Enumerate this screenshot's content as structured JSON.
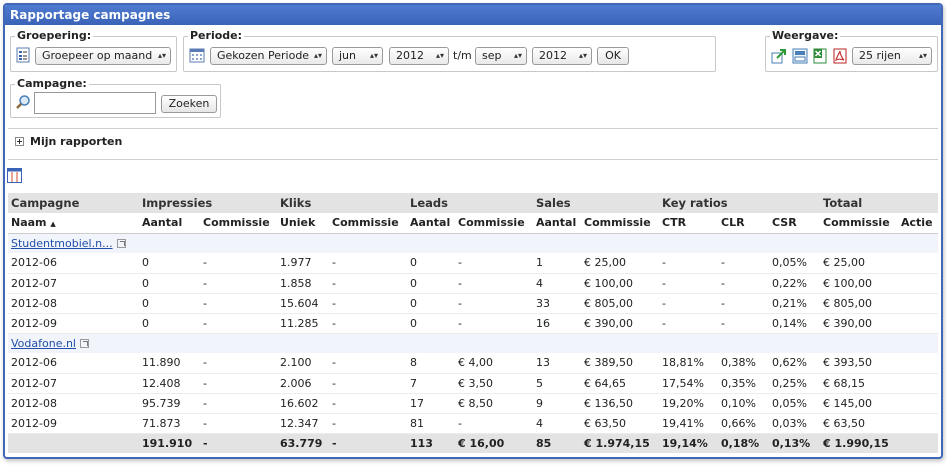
{
  "panel": {
    "title": "Rapportage campagnes"
  },
  "grouping": {
    "legend": "Groepering:",
    "value": "Groepeer op maand"
  },
  "period": {
    "legend": "Periode:",
    "mode": "Gekozen Periode",
    "from_month": "jun",
    "from_year": "2012",
    "separator": "t/m",
    "to_month": "sep",
    "to_year": "2012",
    "ok_label": "OK"
  },
  "view": {
    "legend": "Weergave:",
    "rows": "25 rijen"
  },
  "campaign_search": {
    "legend": "Campagne:",
    "value": "",
    "button": "Zoeken"
  },
  "my_reports": {
    "label": "Mijn rapporten"
  },
  "table": {
    "groups": [
      "Campagne",
      "Impressies",
      "Kliks",
      "Leads",
      "Sales",
      "Key ratios",
      "Totaal"
    ],
    "columns": [
      "Naam",
      "Aantal",
      "Commissie",
      "Uniek",
      "Commissie",
      "Aantal",
      "Commissie",
      "Aantal",
      "Commissie",
      "CTR",
      "CLR",
      "CSR",
      "Commissie",
      "Actie"
    ],
    "sort_indicator": "▲",
    "campaigns": [
      {
        "name": "Studentmobiel.n...",
        "rows": [
          [
            "2012-06",
            "0",
            "-",
            "1.977",
            "-",
            "0",
            "-",
            "1",
            "€ 25,00",
            "-",
            "-",
            "0,05%",
            "€ 25,00",
            ""
          ],
          [
            "2012-07",
            "0",
            "-",
            "1.858",
            "-",
            "0",
            "-",
            "4",
            "€ 100,00",
            "-",
            "-",
            "0,22%",
            "€ 100,00",
            ""
          ],
          [
            "2012-08",
            "0",
            "-",
            "15.604",
            "-",
            "0",
            "-",
            "33",
            "€ 805,00",
            "-",
            "-",
            "0,21%",
            "€ 805,00",
            ""
          ],
          [
            "2012-09",
            "0",
            "-",
            "11.285",
            "-",
            "0",
            "-",
            "16",
            "€ 390,00",
            "-",
            "-",
            "0,14%",
            "€ 390,00",
            ""
          ]
        ]
      },
      {
        "name": "Vodafone.nl",
        "rows": [
          [
            "2012-06",
            "11.890",
            "-",
            "2.100",
            "-",
            "8",
            "€ 4,00",
            "13",
            "€ 389,50",
            "18,81%",
            "0,38%",
            "0,62%",
            "€ 393,50",
            ""
          ],
          [
            "2012-07",
            "12.408",
            "-",
            "2.006",
            "-",
            "7",
            "€ 3,50",
            "5",
            "€ 64,65",
            "17,54%",
            "0,35%",
            "0,25%",
            "€ 68,15",
            ""
          ],
          [
            "2012-08",
            "95.739",
            "-",
            "16.602",
            "-",
            "17",
            "€ 8,50",
            "9",
            "€ 136,50",
            "19,20%",
            "0,10%",
            "0,05%",
            "€ 145,00",
            ""
          ],
          [
            "2012-09",
            "71.873",
            "-",
            "12.347",
            "-",
            "81",
            "-",
            "4",
            "€ 63,50",
            "19,41%",
            "0,66%",
            "0,03%",
            "€ 63,50",
            ""
          ]
        ]
      }
    ],
    "total": [
      "",
      "191.910",
      "-",
      "63.779",
      "-",
      "113",
      "€ 16,00",
      "85",
      "€ 1.974,15",
      "19,14%",
      "0,18%",
      "0,13%",
      "€ 1.990,15",
      ""
    ]
  },
  "colors": {
    "accent": "#3a63b8",
    "link": "#1f4fa8",
    "header_bg": "#e3e3e3"
  },
  "icons": [
    "group-list-icon",
    "calendar-icon",
    "export-icon",
    "print-icon",
    "excel-icon",
    "pdf-icon",
    "search-icon",
    "expand-icon",
    "column-chooser-icon"
  ]
}
